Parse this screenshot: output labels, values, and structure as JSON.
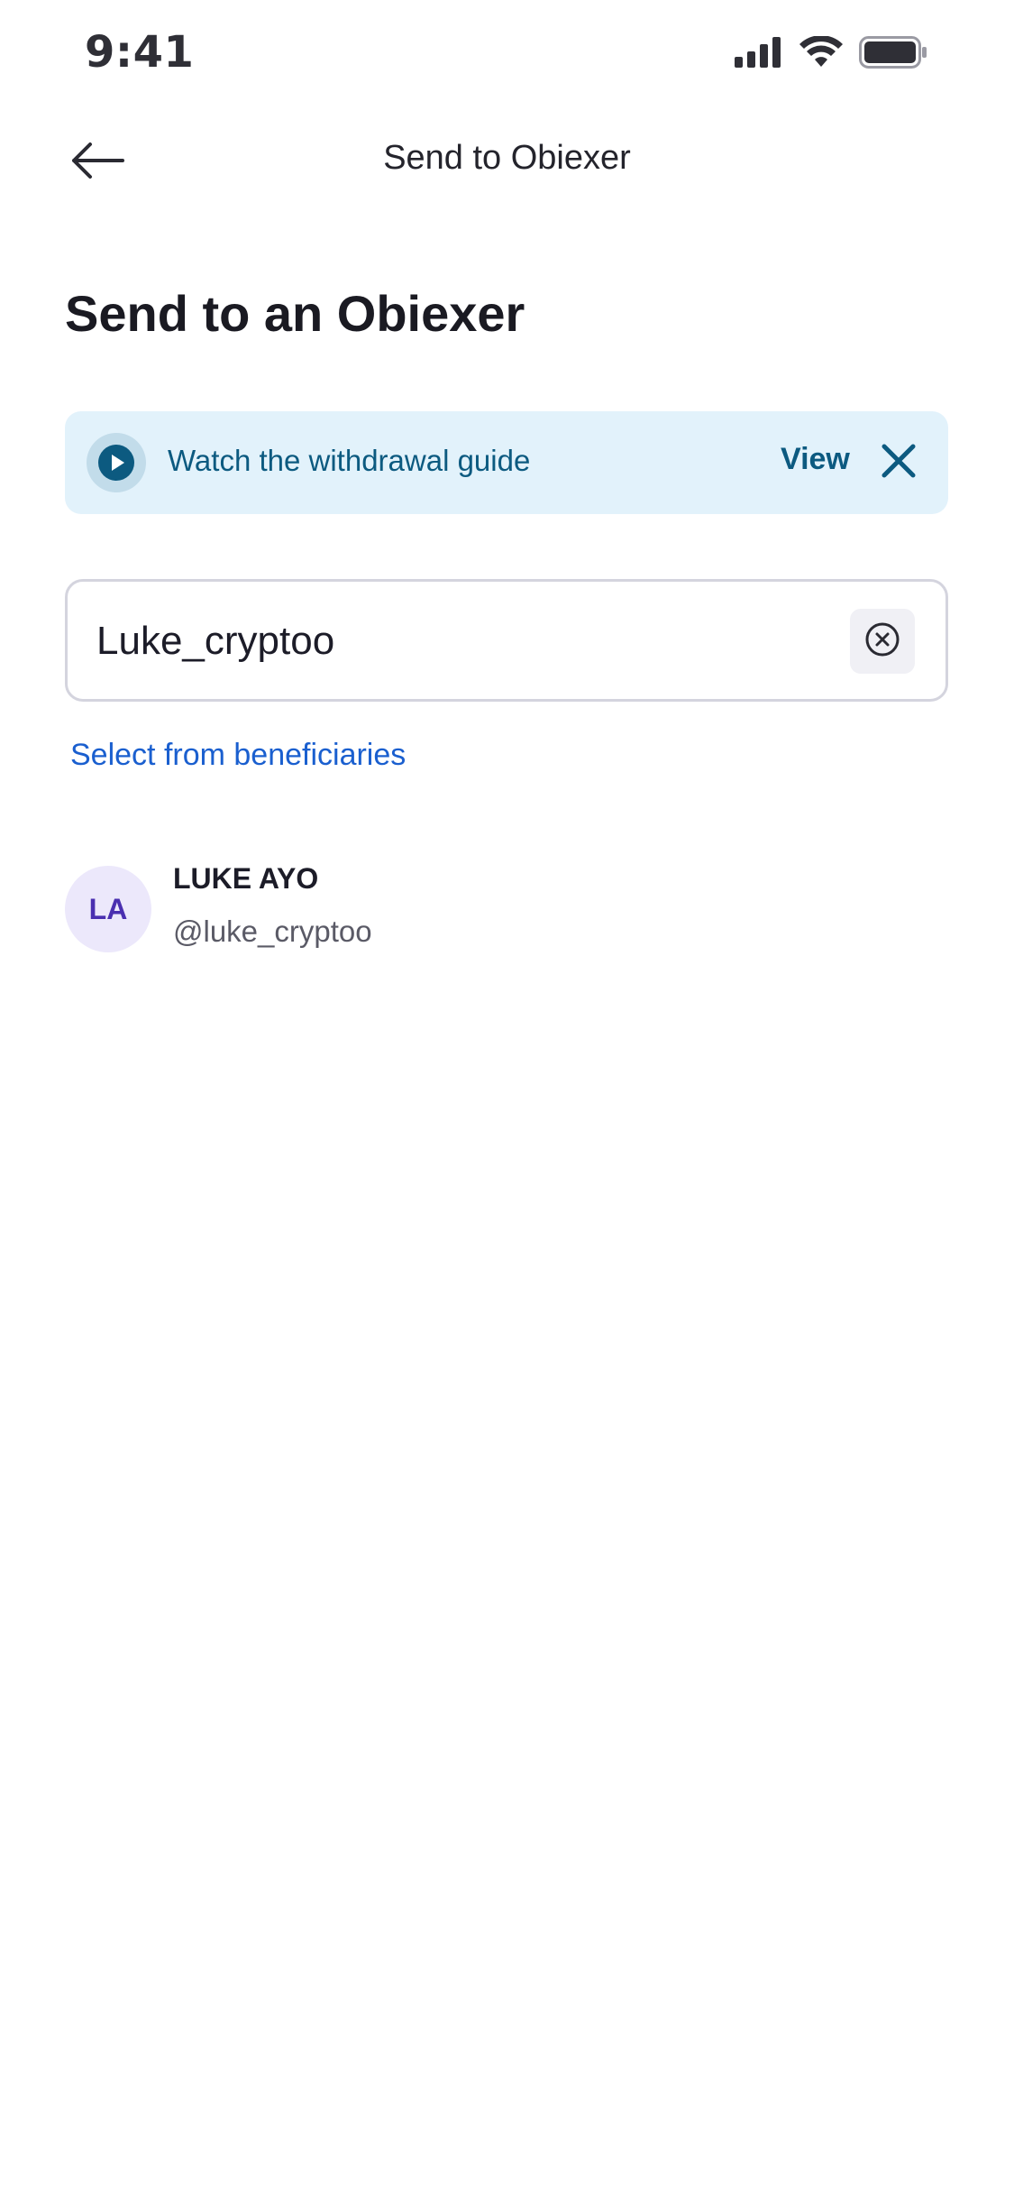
{
  "status_bar": {
    "time": "9:41"
  },
  "header": {
    "title": "Send to Obiexer"
  },
  "page": {
    "title": "Send to an Obiexer"
  },
  "guide_banner": {
    "text": "Watch the withdrawal guide",
    "view_label": "View"
  },
  "search": {
    "value": "Luke_cryptoo",
    "placeholder": ""
  },
  "beneficiaries_link": "Select from beneficiaries",
  "results": [
    {
      "initials": "LA",
      "name": "LUKE AYO",
      "handle": "@luke_cryptoo"
    }
  ],
  "colors": {
    "banner_bg": "#e2f2fb",
    "banner_text": "#0c5a80",
    "link": "#1a5fcf",
    "avatar_bg": "#ece8fb",
    "avatar_text": "#4a2fb0"
  },
  "icons": {
    "back": "arrow-left-icon",
    "play": "play-circle-icon",
    "close": "close-icon",
    "clear": "clear-circle-icon",
    "signal": "cellular-signal-icon",
    "wifi": "wifi-icon",
    "battery": "battery-icon"
  }
}
